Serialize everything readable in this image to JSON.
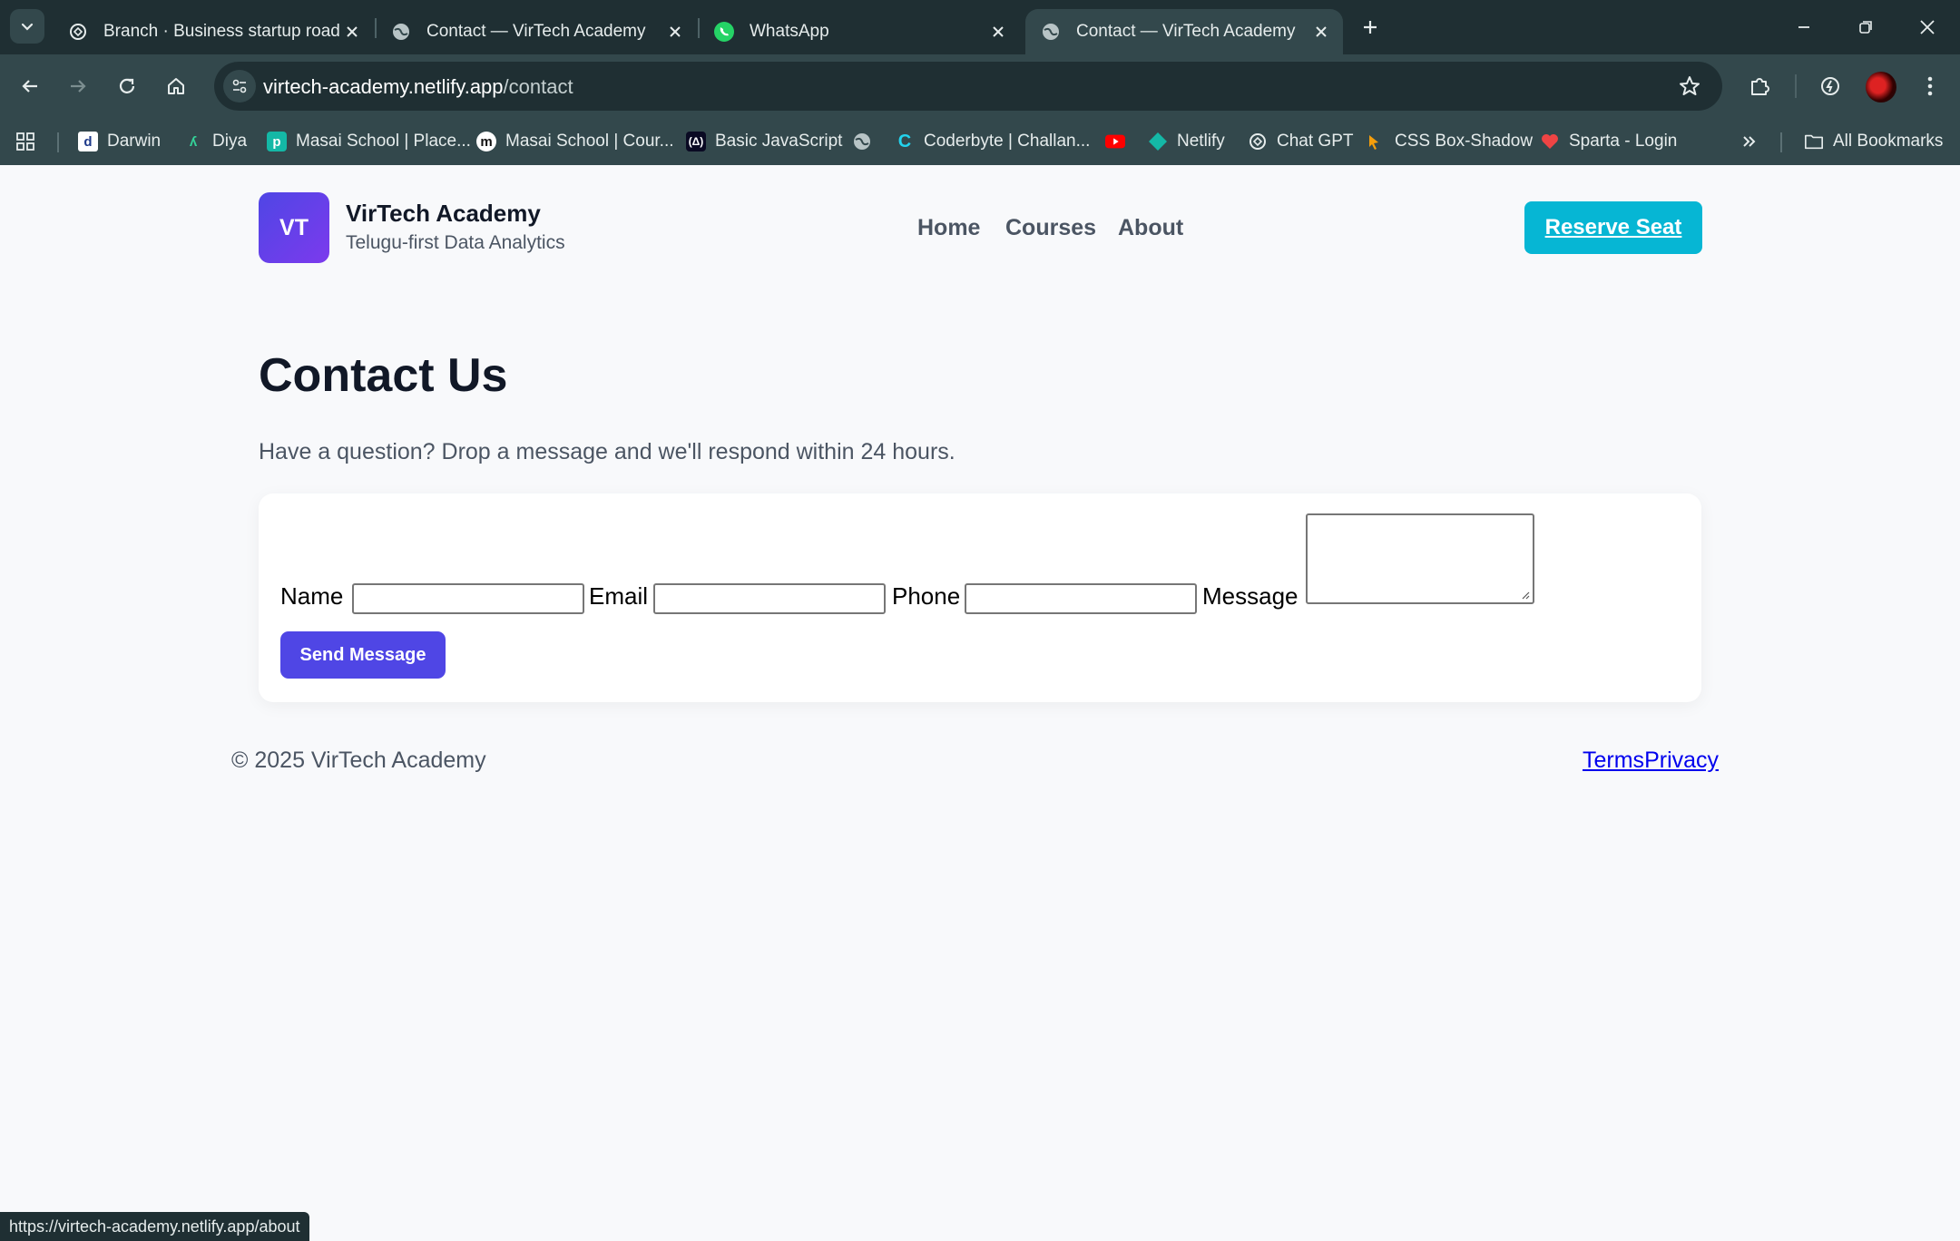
{
  "browser": {
    "tabs": [
      {
        "title": "Branch · Business startup roadmap",
        "favicon": "openai-icon",
        "active": false
      },
      {
        "title": "Contact — VirTech Academy",
        "favicon": "globe-icon",
        "active": false
      },
      {
        "title": "WhatsApp",
        "favicon": "whatsapp-icon",
        "active": false
      },
      {
        "title": "Contact — VirTech Academy",
        "favicon": "globe-icon",
        "active": true
      }
    ],
    "url_host": "virtech-academy.netlify.app",
    "url_path": "/contact",
    "bookmarks": [
      {
        "label": "Darwin",
        "icon": "darwin-icon"
      },
      {
        "label": "Diya",
        "icon": "diya-icon"
      },
      {
        "label": "Masai School | Place...",
        "icon": "masai-p-icon"
      },
      {
        "label": "Masai School | Cour...",
        "icon": "masai-m-icon"
      },
      {
        "label": "Basic JavaScript",
        "icon": "freecodecamp-icon"
      },
      {
        "label": "",
        "icon": "globe-icon"
      },
      {
        "label": "Coderbyte | Challan...",
        "icon": "coderbyte-icon"
      },
      {
        "label": "",
        "icon": "youtube-icon"
      },
      {
        "label": "Netlify",
        "icon": "netlify-icon"
      },
      {
        "label": "Chat GPT",
        "icon": "openai-icon"
      },
      {
        "label": "CSS Box-Shadow",
        "icon": "cssbox-icon"
      },
      {
        "label": "Sparta - Login",
        "icon": "sparta-icon"
      }
    ],
    "all_bookmarks_label": "All Bookmarks",
    "status_url": "https://virtech-academy.netlify.app/about"
  },
  "site": {
    "logo_text": "VT",
    "brand_name": "VirTech Academy",
    "brand_tagline": "Telugu-first Data Analytics",
    "nav": [
      "Home",
      "Courses",
      "About"
    ],
    "cta_label": "Reserve Seat",
    "colors": {
      "primary": "#4f46e5",
      "accent": "#06b6d4"
    }
  },
  "contact": {
    "heading": "Contact Us",
    "lead": "Have a question? Drop a message and we'll respond within 24 hours.",
    "fields": {
      "name_label": "Name",
      "email_label": "Email",
      "phone_label": "Phone",
      "message_label": "Message",
      "name_value": "",
      "email_value": "",
      "phone_value": "",
      "message_value": ""
    },
    "submit_label": "Send Message"
  },
  "footer": {
    "copyright": "© 2025 VirTech Academy",
    "terms": "Terms",
    "privacy": "Privacy"
  }
}
